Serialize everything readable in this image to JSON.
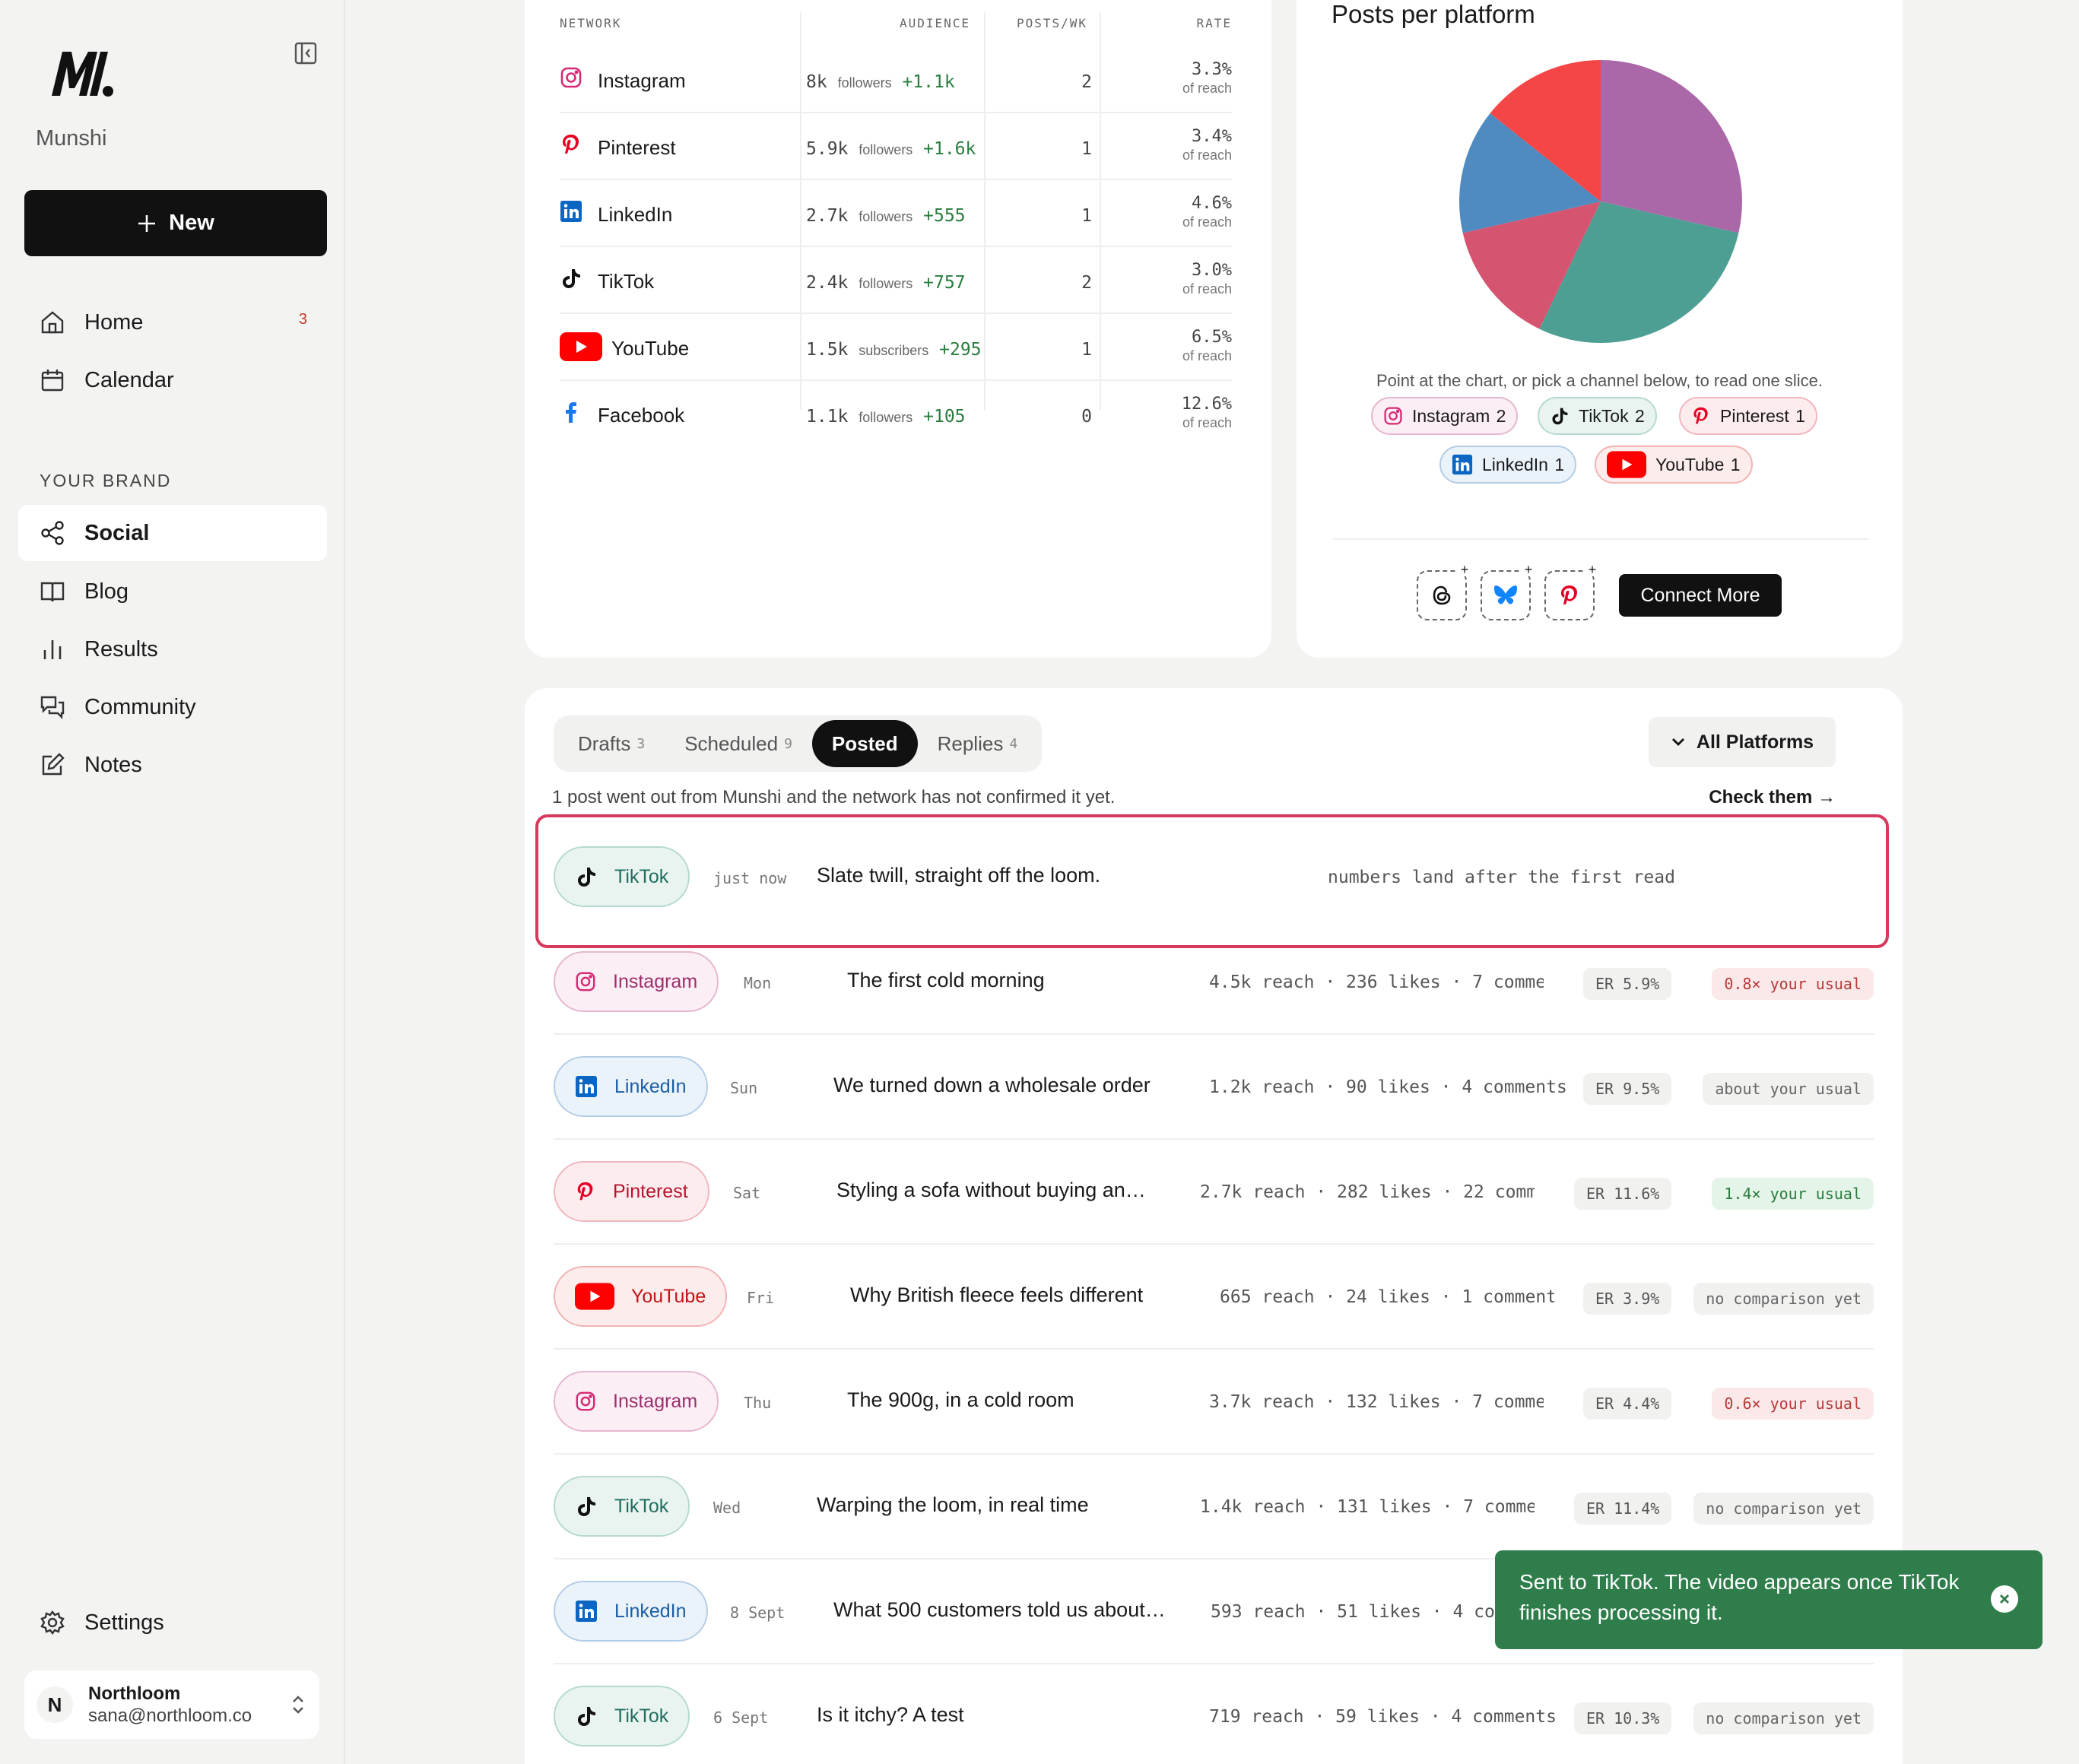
{
  "sidebar": {
    "brand_name": "Munshi",
    "new_label": "New",
    "nav": [
      {
        "label": "Home",
        "badge": "3",
        "icon": "home-icon"
      },
      {
        "label": "Calendar",
        "icon": "calendar-icon"
      }
    ],
    "brand_heading": "YOUR BRAND",
    "brand_nav": [
      {
        "label": "Social",
        "icon": "share-icon",
        "active": true
      },
      {
        "label": "Blog",
        "icon": "book-icon"
      },
      {
        "label": "Results",
        "icon": "bar-chart-icon"
      },
      {
        "label": "Community",
        "icon": "chat-icon"
      },
      {
        "label": "Notes",
        "icon": "edit-icon"
      }
    ],
    "settings_label": "Settings",
    "account": {
      "initial": "N",
      "name": "Northloom",
      "email": "sana@northloom.co"
    }
  },
  "networks": {
    "headers": {
      "network": "NETWORK",
      "audience": "AUDIENCE",
      "posts": "POSTS/WK",
      "rate": "RATE"
    },
    "rows": [
      {
        "name": "Instagram",
        "audience": "8k",
        "unit": "followers",
        "delta": "+1.1k",
        "posts": "2",
        "rate": "3.3%",
        "rate_sub": "of reach"
      },
      {
        "name": "Pinterest",
        "audience": "5.9k",
        "unit": "followers",
        "delta": "+1.6k",
        "posts": "1",
        "rate": "3.4%",
        "rate_sub": "of reach"
      },
      {
        "name": "LinkedIn",
        "audience": "2.7k",
        "unit": "followers",
        "delta": "+555",
        "posts": "1",
        "rate": "4.6%",
        "rate_sub": "of reach"
      },
      {
        "name": "TikTok",
        "audience": "2.4k",
        "unit": "followers",
        "delta": "+757",
        "posts": "2",
        "rate": "3.0%",
        "rate_sub": "of reach"
      },
      {
        "name": "YouTube",
        "audience": "1.5k",
        "unit": "subscribers",
        "delta": "+295",
        "posts": "1",
        "rate": "6.5%",
        "rate_sub": "of reach"
      },
      {
        "name": "Facebook",
        "audience": "1.1k",
        "unit": "followers",
        "delta": "+105",
        "posts": "0",
        "rate": "12.6%",
        "rate_sub": "of reach"
      }
    ]
  },
  "platform_chart": {
    "title": "Posts per platform",
    "hint": "Point at the chart, or pick a channel below, to read one slice.",
    "connect_label": "Connect More"
  },
  "chart_data": {
    "type": "pie",
    "title": "Posts per platform",
    "categories": [
      "Instagram",
      "TikTok",
      "Pinterest",
      "LinkedIn",
      "YouTube"
    ],
    "values": [
      2,
      2,
      1,
      1,
      1
    ],
    "colors": [
      "#ab68a8",
      "#4e9f93",
      "#d55470",
      "#4f8bc0",
      "#f44646"
    ]
  },
  "posts": {
    "tabs": [
      {
        "label": "Drafts",
        "count": "3"
      },
      {
        "label": "Scheduled",
        "count": "9"
      },
      {
        "label": "Posted",
        "count": "",
        "active": true
      },
      {
        "label": "Replies",
        "count": "4"
      }
    ],
    "filter_label": "All Platforms",
    "notice": "1 post went out from Munshi and the network has not confirmed it yet.",
    "check_label": "Check them →",
    "pending": {
      "platform": "TikTok",
      "time": "just now",
      "title": "Slate twill, straight off the loom.",
      "note": "numbers land after the first read"
    },
    "rows": [
      {
        "platform": "Instagram",
        "time": "Mon",
        "title": "The first cold morning",
        "stats": "4.5k reach · 236 likes · 7 comme…",
        "er": "ER 5.9%",
        "cmp": "0.8× your usual",
        "tone": "bad"
      },
      {
        "platform": "LinkedIn",
        "time": "Sun",
        "title": "We turned down a wholesale order",
        "stats": "1.2k reach · 90 likes · 4 comments",
        "er": "ER 9.5%",
        "cmp": "about your usual",
        "tone": "neutral"
      },
      {
        "platform": "Pinterest",
        "time": "Sat",
        "title": "Styling a sofa without buying an…",
        "stats": "2.7k reach · 282 likes · 22 comm…",
        "er": "ER 11.6%",
        "cmp": "1.4× your usual",
        "tone": "good"
      },
      {
        "platform": "YouTube",
        "time": "Fri",
        "title": "Why British fleece feels different",
        "stats": "665 reach · 24 likes · 1 comments",
        "er": "ER 3.9%",
        "cmp": "no comparison yet",
        "tone": "neutral"
      },
      {
        "platform": "Instagram",
        "time": "Thu",
        "title": "The 900g, in a cold room",
        "stats": "3.7k reach · 132 likes · 7 comme…",
        "er": "ER 4.4%",
        "cmp": "0.6× your usual",
        "tone": "bad"
      },
      {
        "platform": "TikTok",
        "time": "Wed",
        "title": "Warping the loom, in real time",
        "stats": "1.4k reach · 131 likes · 7 comme…",
        "er": "ER 11.4%",
        "cmp": "no comparison yet",
        "tone": "neutral"
      },
      {
        "platform": "LinkedIn",
        "time": "8 Sept",
        "title": "What 500 customers told us about…",
        "stats": "593 reach · 51 likes · 4 co",
        "er": "",
        "cmp": "",
        "tone": "neutral"
      },
      {
        "platform": "TikTok",
        "time": "6 Sept",
        "title": "Is it itchy? A test",
        "stats": "719 reach · 59 likes · 4 comments",
        "er": "ER 10.3%",
        "cmp": "no comparison yet",
        "tone": "neutral"
      }
    ]
  },
  "toast": {
    "message": "Sent to TikTok. The video appears once TikTok finishes processing it."
  },
  "colors": {
    "accent": "#111111",
    "highlight": "#d63a5c",
    "toast": "#2f7d4b",
    "instagram": "#d62976",
    "pinterest": "#e60023",
    "linkedin": "#0a66c2",
    "youtube": "#ff0000",
    "facebook": "#1877f2"
  }
}
